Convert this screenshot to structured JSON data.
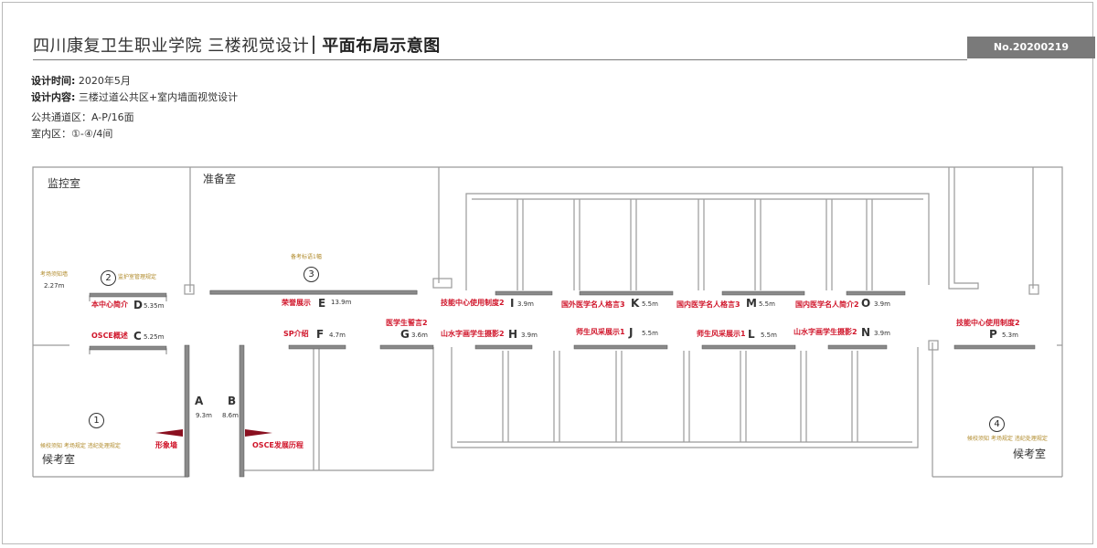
{
  "header": {
    "title_main": "四川康复卫生职业学院 三楼视觉设计",
    "title_sub": "平面布局示意图",
    "doc_no": "No.20200219"
  },
  "meta": {
    "time_label": "设计时间:",
    "time_value": "2020年5月",
    "content_label": "设计内容:",
    "content_value": "三楼过道公共区+室内墙面视觉设计",
    "public_area": "公共通道区：A-P/16面",
    "indoor_area": "室内区：①-④/4间"
  },
  "rooms": {
    "monitor": "监控室",
    "prep": "准备室",
    "wait_left": "候考室",
    "wait_right": "候考室"
  },
  "circles": {
    "c1": "1",
    "c2": "2",
    "c3": "3",
    "c4": "4"
  },
  "walls": {
    "A": {
      "letter": "A",
      "size": "9.3m",
      "title": "形象墙"
    },
    "B": {
      "letter": "B",
      "size": "8.6m",
      "title": "OSCE发展历程"
    },
    "C": {
      "letter": "C",
      "size": "5.25m",
      "title": "OSCE概述"
    },
    "D": {
      "letter": "D",
      "size": "5.35m",
      "title": "本中心简介"
    },
    "E": {
      "letter": "E",
      "size": "13.9m",
      "title": "荣誉展示"
    },
    "F": {
      "letter": "F",
      "size": "4.7m",
      "title": "SP介绍"
    },
    "G": {
      "letter": "G",
      "size": "3.6m",
      "title": "医学生誓言2"
    },
    "H": {
      "letter": "H",
      "size": "3.9m",
      "title": "山水字画学生摄影2"
    },
    "I": {
      "letter": "I",
      "size": "3.9m",
      "title": "技能中心使用制度2"
    },
    "J": {
      "letter": "J",
      "size": "5.5m",
      "title": "师生风采展示1"
    },
    "K": {
      "letter": "K",
      "size": "5.5m",
      "title": "国外医学名人格言3"
    },
    "L": {
      "letter": "L",
      "size": "5.5m",
      "title": "师生风采展示1"
    },
    "M": {
      "letter": "M",
      "size": "5.5m",
      "title": "国内医学名人格言3"
    },
    "N": {
      "letter": "N",
      "size": "3.9m",
      "title": "山水字画学生摄影2"
    },
    "O": {
      "letter": "O",
      "size": "3.9m",
      "title": "国内医学名人简介2"
    },
    "P": {
      "letter": "P",
      "size": "5.3m",
      "title": "技能中心使用制度2"
    }
  },
  "notes": {
    "monitor_note": "考场须知墙",
    "monitor_size": "2.27m",
    "r2_note": "监护室管理规定",
    "r3_note": "备考标语1幅",
    "r1_note": "候校须知  考场规定  违纪处理规定",
    "r4_note": "候校须知  考场规定  违纪处理规定"
  },
  "colors": {
    "accent_red": "#d0152a",
    "note_gold": "#b08a2a",
    "wall_grey": "#8a8a8a",
    "header_bar": "#7a7a7a"
  }
}
